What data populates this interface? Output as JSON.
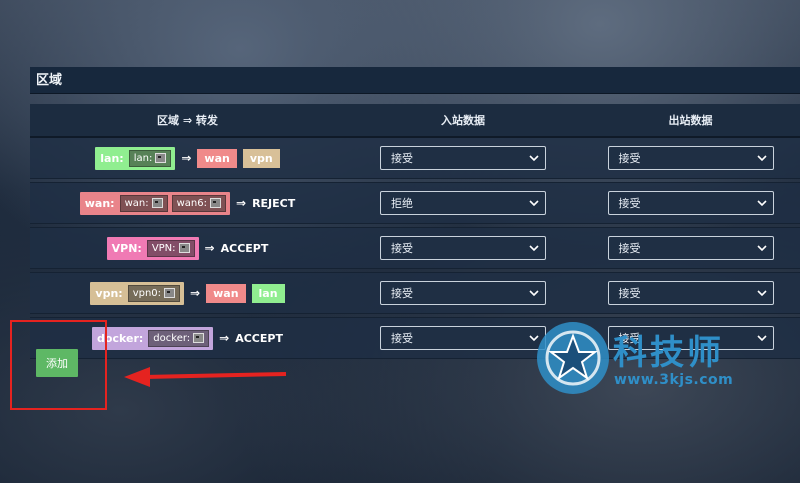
{
  "panel": {
    "title": "区域"
  },
  "table": {
    "headers": [
      "区域 ⇒ 转发",
      "入站数据",
      "出站数据"
    ],
    "rows": [
      {
        "zone_label": "lan:",
        "zone_color": "#90ee90",
        "ifaces": [
          "lan:"
        ],
        "dests": [
          {
            "label": "wan",
            "color": "#f08a8a"
          },
          {
            "label": "vpn",
            "color": "#d8c098"
          }
        ],
        "policy": "",
        "input": "接受",
        "output": "接受"
      },
      {
        "zone_label": "wan:",
        "zone_color": "#e9848a",
        "ifaces": [
          "wan:",
          "wan6:"
        ],
        "dests": [],
        "policy": "REJECT",
        "input": "拒绝",
        "output": "接受"
      },
      {
        "zone_label": "VPN:",
        "zone_color": "#f07ab4",
        "ifaces": [
          "VPN:"
        ],
        "dests": [],
        "policy": "ACCEPT",
        "input": "接受",
        "output": "接受"
      },
      {
        "zone_label": "vpn:",
        "zone_color": "#d6bf96",
        "ifaces": [
          "vpn0:"
        ],
        "dests": [
          {
            "label": "wan",
            "color": "#f08a8a"
          },
          {
            "label": "lan",
            "color": "#90ee90"
          }
        ],
        "policy": "",
        "input": "接受",
        "output": "接受"
      },
      {
        "zone_label": "docker:",
        "zone_color": "#c2a5dc",
        "ifaces": [
          "docker:"
        ],
        "dests": [],
        "policy": "ACCEPT",
        "input": "接受",
        "output": "接受"
      }
    ],
    "arrow": "⇒"
  },
  "actions": {
    "add_label": "添加"
  },
  "watermark": {
    "brand": "科技师",
    "url": "www.3kjs.com"
  },
  "icons": [
    "network-interface-icon",
    "chevron-down-icon",
    "red-arrow-icon",
    "watermark-logo-icon"
  ]
}
